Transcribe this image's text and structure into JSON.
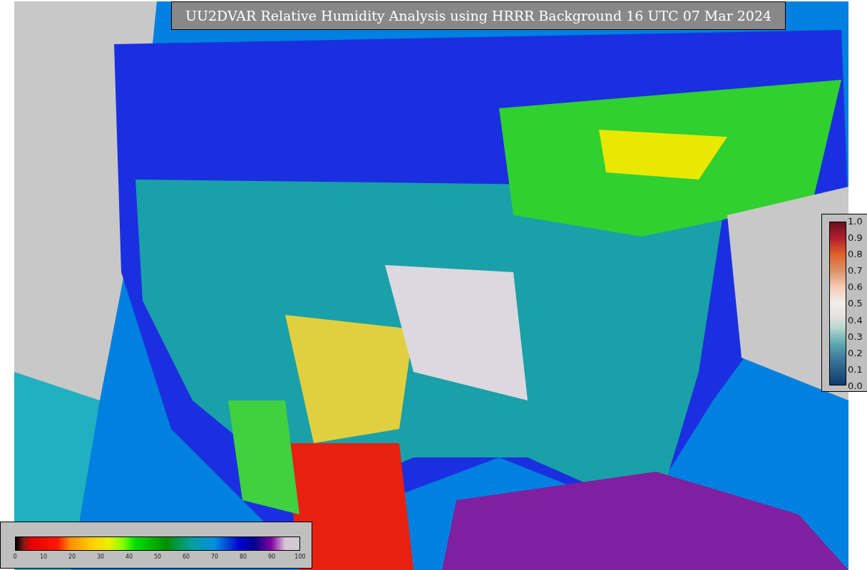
{
  "title": "UU2DVAR Relative Humidity Analysis using HRRR Background 16 UTC 07 Mar 2024",
  "humidity_colorbar": {
    "ticks": [
      "0",
      "10",
      "20",
      "30",
      "40",
      "50",
      "60",
      "70",
      "80",
      "90",
      "100"
    ]
  },
  "ratio_colorbar": {
    "ticks": [
      "1.0",
      "0.9",
      "0.8",
      "0.7",
      "0.6",
      "0.5",
      "0.4",
      "0.3",
      "0.2",
      "0.1",
      "0.0"
    ]
  }
}
